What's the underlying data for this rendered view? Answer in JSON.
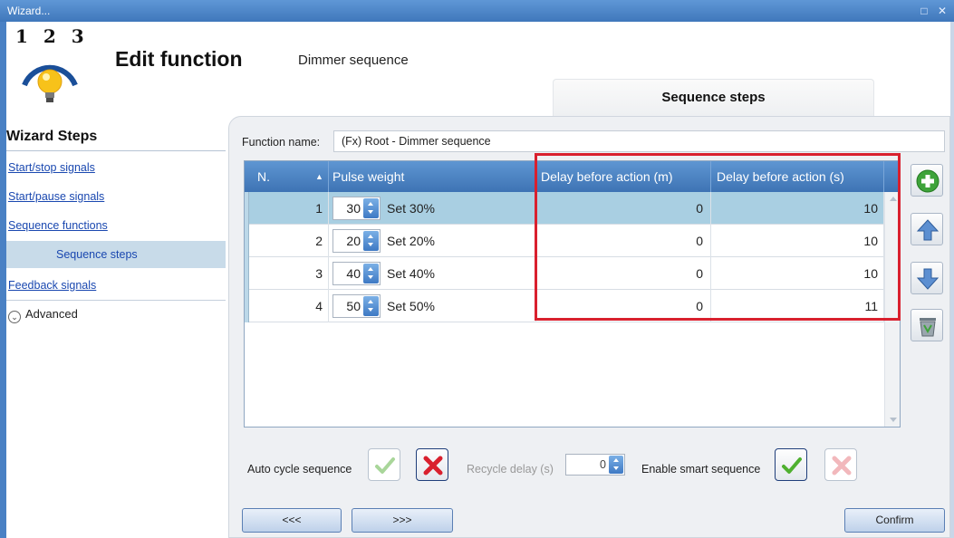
{
  "window": {
    "title": "Wizard...",
    "controls": "□ ✕"
  },
  "header": {
    "logo_digits": "1 2 3",
    "title": "Edit function",
    "subtitle": "Dimmer sequence",
    "active_tab": "Sequence steps"
  },
  "sidebar": {
    "title": "Wizard Steps",
    "items": [
      {
        "label": "Start/stop signals",
        "active": false
      },
      {
        "label": "Start/pause signals",
        "active": false
      },
      {
        "label": "Sequence functions",
        "active": false
      },
      {
        "label": "Sequence steps",
        "active": true
      },
      {
        "label": "Feedback signals",
        "active": false
      }
    ],
    "advanced_label": "Advanced"
  },
  "form": {
    "function_name_label": "Function name:",
    "function_name_value": "(Fx) Root - Dimmer sequence"
  },
  "grid": {
    "columns": [
      "N.",
      "Pulse weight",
      "Delay before action (m)",
      "Delay before action (s)"
    ],
    "sort_indicator": "▲",
    "rows": [
      {
        "n": "1",
        "pulse": "30",
        "set": "Set 30%",
        "delay_m": "0",
        "delay_s": "10",
        "selected": true
      },
      {
        "n": "2",
        "pulse": "20",
        "set": "Set 20%",
        "delay_m": "0",
        "delay_s": "10",
        "selected": false
      },
      {
        "n": "3",
        "pulse": "40",
        "set": "Set 40%",
        "delay_m": "0",
        "delay_s": "10",
        "selected": false
      },
      {
        "n": "4",
        "pulse": "50",
        "set": "Set 50%",
        "delay_m": "0",
        "delay_s": "11",
        "selected": false
      }
    ]
  },
  "side_buttons": [
    "add-icon",
    "move-up-icon",
    "move-down-icon",
    "delete-icon"
  ],
  "options": {
    "auto_cycle_label": "Auto cycle sequence",
    "recycle_delay_label": "Recycle delay (s)",
    "recycle_delay_value": "0",
    "smart_sequence_label": "Enable smart sequence",
    "auto_cycle_enabled": false,
    "smart_sequence_enabled": true
  },
  "footer": {
    "prev_label": "<<<",
    "next_label": ">>>",
    "confirm_label": "Confirm"
  },
  "colors": {
    "accent": "#3e73b4",
    "highlight_box": "#d9202e",
    "selected_row": "#a9cfe2",
    "check_green": "#5fbf3a",
    "cross_red": "#d9202e"
  }
}
